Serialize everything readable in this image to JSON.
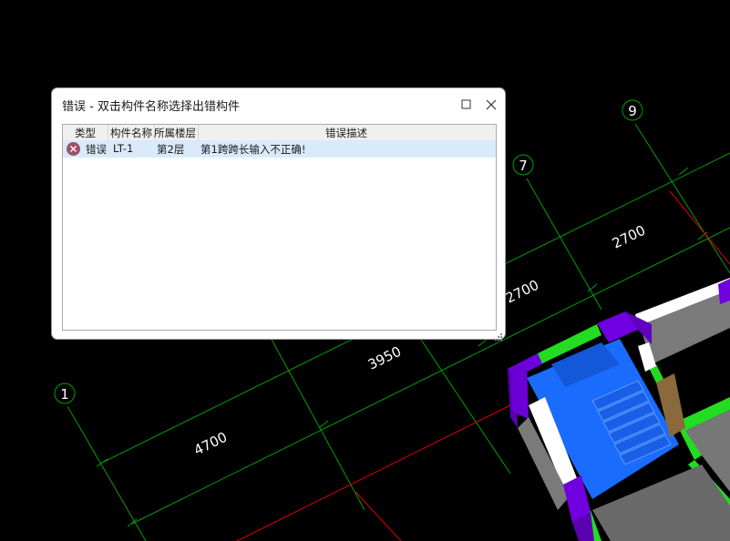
{
  "dialog": {
    "title": "错误 - 双击构件名称选择出错构件",
    "maximize_icon": "maximize-icon",
    "close_icon": "close-icon",
    "columns": {
      "type": "类型",
      "name": "构件名称",
      "floor": "所属楼层",
      "desc": "错误描述"
    },
    "rows": [
      {
        "icon": "error-circle-x-icon",
        "type": "错误",
        "name": "LT-1",
        "floor": "第2层",
        "desc": "第1跨跨长输入不正确!"
      }
    ]
  },
  "cad": {
    "axis_labels": [
      "1",
      "7",
      "9"
    ],
    "dimensions": [
      "4700",
      "3950",
      "2700",
      "2700"
    ],
    "colors": {
      "background": "#000000",
      "grid_line": "#00a000",
      "red_axis": "#e00000",
      "wall_purple": "#7000e0",
      "wall_green": "#22dd22",
      "floor_blue": "#1a6cff",
      "wall_gray": "#7a7a7a"
    }
  }
}
